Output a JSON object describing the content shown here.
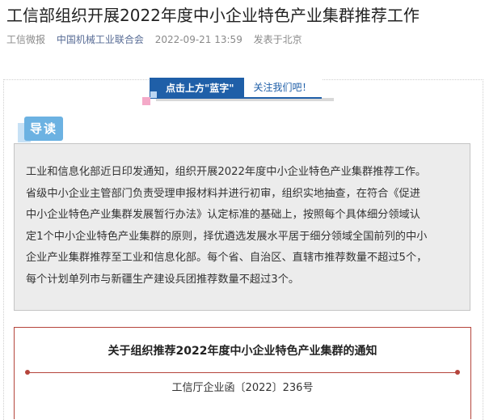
{
  "article": {
    "title": "工信部组织开展2022年度中小企业特色产业集群推荐工作",
    "meta": {
      "source": "工信微报",
      "author": "中国机械工业联合会",
      "datetime": "2022-09-21 13:59",
      "location": "发表于北京"
    }
  },
  "follow_banner": {
    "left_text": "点击上方\"蓝字\"",
    "right_text": "关注我们吧！",
    "colors": {
      "primary": "#1f5fa8",
      "pink": "#f4a9c8",
      "light_blue": "#bcd6f2"
    }
  },
  "intro": {
    "tag": "导读",
    "lines": [
      "工业和信息化部近日印发通知，组织开展2022年度中小企业特色产业集群推荐工作。",
      "省级中小企业主管部门负责受理申报材料并进行初审，组织实地抽查，在符合《促进",
      "中小企业特色产业集群发展暂行办法》认定标准的基础上，按照每个具体细分领域认",
      "定1个中小企业特色产业集群的原则，择优遴选发展水平居于细分领域全国前列的中小",
      "企业产业集群推荐至工业和信息化部。每个省、自治区、直辖市推荐数量不超过5个，",
      "每个计划单列市与新疆生产建设兵团推荐数量不超过3个。"
    ],
    "colors": {
      "tag": "#6cb2e2",
      "box": "#ececec"
    }
  },
  "notice": {
    "title": "关于组织推荐2022年度中小企业特色产业集群的通知",
    "doc_number": "工信厅企业函〔2022〕236号",
    "colors": {
      "border": "#b5453c"
    }
  }
}
